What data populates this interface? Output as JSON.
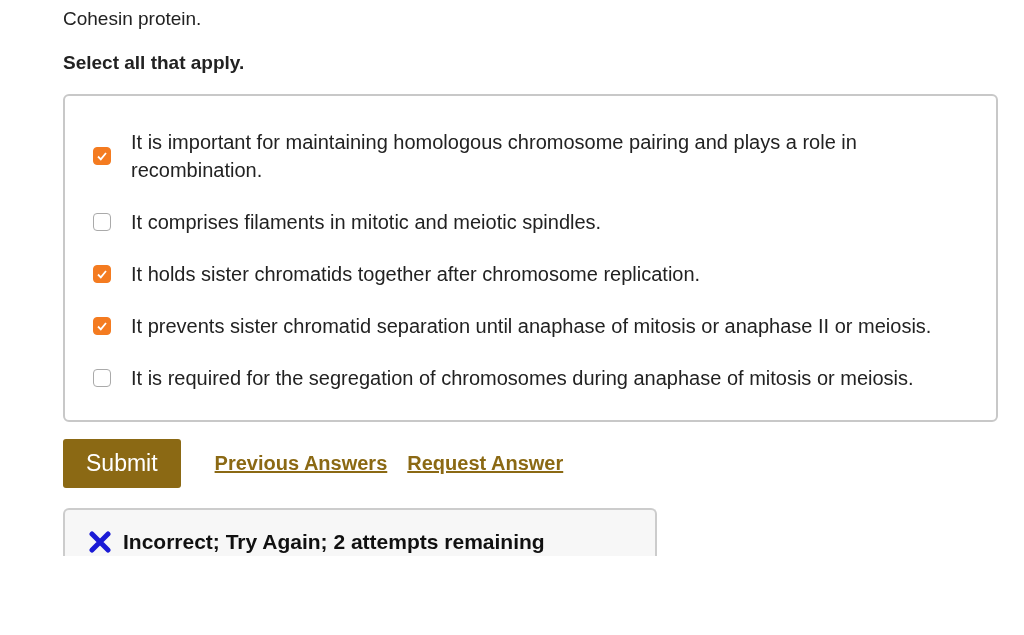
{
  "question": {
    "prompt": "Cohesin protein.",
    "instruction": "Select all that apply."
  },
  "options": [
    {
      "label": "It is important for maintaining homologous chromosome pairing and plays a role in recombination.",
      "checked": true
    },
    {
      "label": "It comprises filaments in mitotic and meiotic spindles.",
      "checked": false
    },
    {
      "label": "It holds sister chromatids together after chromosome replication.",
      "checked": true
    },
    {
      "label": "It prevents sister chromatid separation until anaphase of mitosis or anaphase II or meiosis.",
      "checked": true
    },
    {
      "label": "It is required for the segregation of chromosomes during anaphase of mitosis or meiosis.",
      "checked": false
    }
  ],
  "actions": {
    "submit": "Submit",
    "links": [
      "Previous Answers",
      "Request Answer"
    ]
  },
  "feedback": {
    "kind": "incorrect",
    "message": "Incorrect; Try Again; 2 attempts remaining"
  }
}
